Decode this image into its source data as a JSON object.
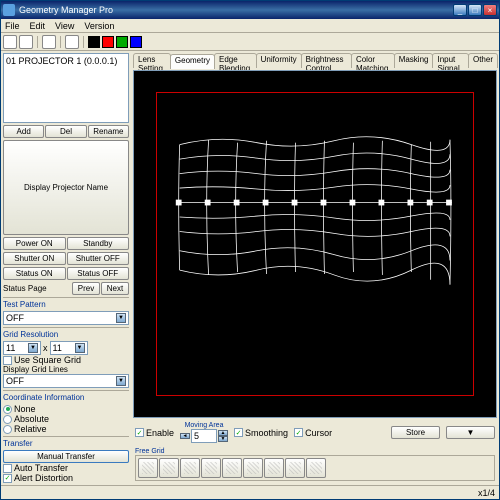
{
  "window": {
    "title": "Geometry Manager Pro"
  },
  "menu": {
    "file": "File",
    "edit": "Edit",
    "view": "View",
    "version": "Version"
  },
  "colors": {
    "black": "#000000",
    "red": "#ff0000",
    "green": "#00aa00",
    "blue": "#0000ff"
  },
  "tree": {
    "item1": "01  PROJECTOR 1 (0.0.0.1)"
  },
  "sidebar": {
    "add": "Add",
    "del": "Del",
    "rename": "Rename",
    "display_name": "Display Projector Name",
    "power_on": "Power ON",
    "standby": "Standby",
    "shutter_on": "Shutter ON",
    "shutter_off": "Shutter OFF",
    "status_on": "Status ON",
    "status_off": "Status OFF",
    "status_page": "Status Page",
    "prev": "Prev",
    "next": "Next"
  },
  "test_pattern": {
    "title": "Test Pattern",
    "value": "OFF"
  },
  "grid_res": {
    "title": "Grid Resolution",
    "w": "11",
    "x": "x",
    "h": "11",
    "use_square": "Use Square Grid",
    "display_lines": "Display Grid Lines",
    "display_lines_value": "OFF"
  },
  "coord": {
    "title": "Coordinate Information",
    "none": "None",
    "absolute": "Absolute",
    "relative": "Relative"
  },
  "transfer": {
    "title": "Transfer",
    "manual": "Manual Transfer",
    "auto": "Auto Transfer",
    "alert": "Alert Distortion"
  },
  "tabs": {
    "lens": "Lens Setting",
    "geometry": "Geometry",
    "edge": "Edge Blending",
    "uniformity": "Uniformity",
    "brightness": "Brightness Control",
    "color": "Color Matching",
    "masking": "Masking",
    "input": "Input Signal",
    "other": "Other"
  },
  "controls": {
    "enable": "Enable",
    "moving_area": "Moving Area",
    "moving_value": "5",
    "smoothing": "Smoothing",
    "cursor": "Cursor",
    "store": "Store",
    "free_grid": "Free Grid"
  },
  "status": {
    "zoom": "x1/4"
  }
}
